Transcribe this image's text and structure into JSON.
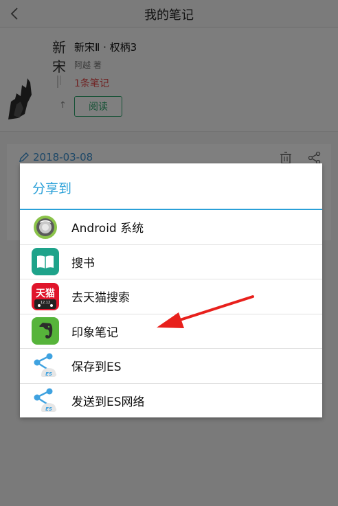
{
  "header": {
    "title": "我的笔记"
  },
  "book": {
    "title": "新宋Ⅱ · 权柄3",
    "author": "阿越 著",
    "note_count": "1条笔记",
    "read_label": "阅读",
    "cover_text": "新宋"
  },
  "note": {
    "date": "2018-03-08"
  },
  "share_dialog": {
    "title": "分享到",
    "items": [
      {
        "label": "Android 系统",
        "icon": "android-system-icon"
      },
      {
        "label": "搜书",
        "icon": "book-search-icon"
      },
      {
        "label": "去天猫搜索",
        "icon": "tmall-icon",
        "icon_text": "天猫",
        "icon_subtext": "12.12"
      },
      {
        "label": "印象笔记",
        "icon": "evernote-icon"
      },
      {
        "label": "保存到ES",
        "icon": "es-share-icon",
        "icon_text": "ES"
      },
      {
        "label": "发送到ES网络",
        "icon": "es-network-icon",
        "icon_text": "ES"
      }
    ]
  },
  "colors": {
    "accent_blue": "#2aa0d8",
    "read_green": "#2aa36a",
    "note_red": "#e04848",
    "annotation_red": "#e8201c"
  }
}
